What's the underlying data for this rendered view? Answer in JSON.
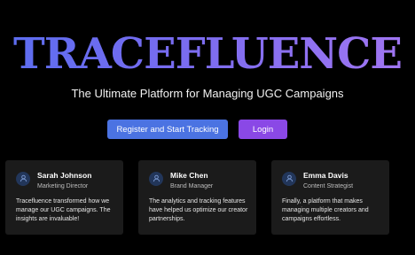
{
  "hero": {
    "title": "TRACEFLUENCE",
    "subtitle": "The Ultimate Platform for Managing UGC Campaigns"
  },
  "actions": {
    "register_label": "Register and Start Tracking",
    "login_label": "Login"
  },
  "colors": {
    "background": "#000000",
    "register_button": "#4b73e2",
    "login_button": "#8a48e6",
    "card_background": "#1b1b1b",
    "avatar_background": "#22365a",
    "title_gradient_start": "#5b6df0",
    "title_gradient_end": "#a276f2"
  },
  "testimonials": [
    {
      "icon": "user-icon",
      "name": "Sarah Johnson",
      "role": "Marketing Director",
      "quote": "Tracefluence transformed how we manage our UGC campaigns. The insights are invaluable!"
    },
    {
      "icon": "user-icon",
      "name": "Mike Chen",
      "role": "Brand Manager",
      "quote": "The analytics and tracking features have helped us optimize our creator partnerships."
    },
    {
      "icon": "user-icon",
      "name": "Emma Davis",
      "role": "Content Strategist",
      "quote": "Finally, a platform that makes managing multiple creators and campaigns effortless."
    }
  ]
}
